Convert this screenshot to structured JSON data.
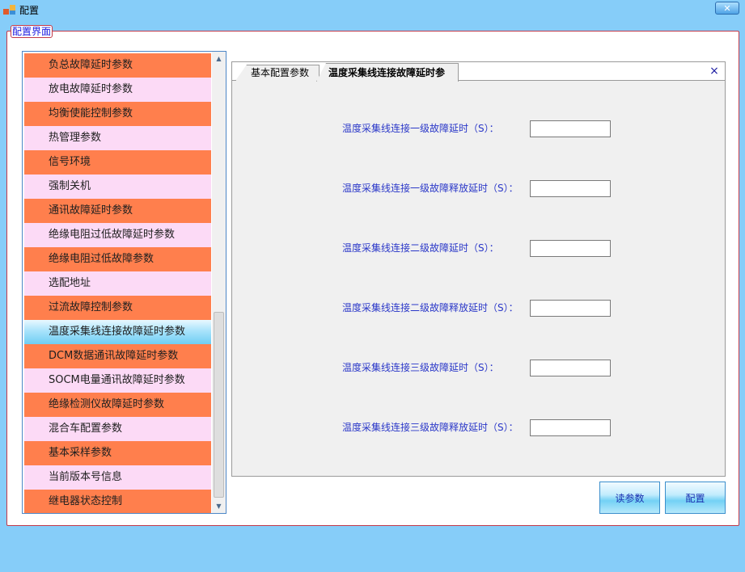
{
  "window": {
    "title": "配置",
    "close_glyph": "✕"
  },
  "group": {
    "label": "配置界面"
  },
  "list": {
    "items": [
      {
        "label": "负总故障延时参数",
        "style": "orange"
      },
      {
        "label": "放电故障延时参数",
        "style": "pink"
      },
      {
        "label": "均衡使能控制参数",
        "style": "orange"
      },
      {
        "label": "热管理参数",
        "style": "pink"
      },
      {
        "label": "信号环境",
        "style": "orange"
      },
      {
        "label": "强制关机",
        "style": "pink"
      },
      {
        "label": "通讯故障延时参数",
        "style": "orange"
      },
      {
        "label": "绝缘电阻过低故障延时参数",
        "style": "pink"
      },
      {
        "label": "绝缘电阻过低故障参数",
        "style": "orange"
      },
      {
        "label": "选配地址",
        "style": "pink"
      },
      {
        "label": "过流故障控制参数",
        "style": "orange"
      },
      {
        "label": "温度采集线连接故障延时参数",
        "style": "selected"
      },
      {
        "label": "DCM数据通讯故障延时参数",
        "style": "orange"
      },
      {
        "label": "SOCM电量通讯故障延时参数",
        "style": "pink"
      },
      {
        "label": "绝缘检测仪故障延时参数",
        "style": "orange"
      },
      {
        "label": "混合车配置参数",
        "style": "pink"
      },
      {
        "label": "基本采样参数",
        "style": "orange"
      },
      {
        "label": "当前版本号信息",
        "style": "pink"
      },
      {
        "label": "继电器状态控制",
        "style": "orange"
      }
    ],
    "scroll_up_glyph": "▲",
    "scroll_down_glyph": "▼"
  },
  "tabs": [
    {
      "label": "基本配置参数",
      "active": false
    },
    {
      "label": "温度采集线连接故障延时参数",
      "active": true
    }
  ],
  "tab_close_glyph": "×",
  "fields": [
    {
      "label": "温度采集线连接一级故障延时（S）：",
      "value": ""
    },
    {
      "label": "温度采集线连接一级故障释放延时（S）：",
      "value": ""
    },
    {
      "label": "温度采集线连接二级故障延时（S）：",
      "value": ""
    },
    {
      "label": "温度采集线连接二级故障释放延时（S）：",
      "value": ""
    },
    {
      "label": "温度采集线连接三级故障延时（S）：",
      "value": ""
    },
    {
      "label": "温度采集线连接三级故障释放延时（S）：",
      "value": ""
    }
  ],
  "buttons": {
    "read": "读参数",
    "config": "配置"
  },
  "colors": {
    "window_bg": "#86cdf9",
    "orange_row": "#ff7f4d",
    "pink_row": "#fcdaf6",
    "label_blue": "#2a37c8",
    "group_border": "#c23a4a"
  },
  "icons": {
    "app": "app-icon",
    "close": "close-icon",
    "tab_close": "close-icon",
    "scroll_up": "arrow-up-icon",
    "scroll_down": "arrow-down-icon"
  }
}
